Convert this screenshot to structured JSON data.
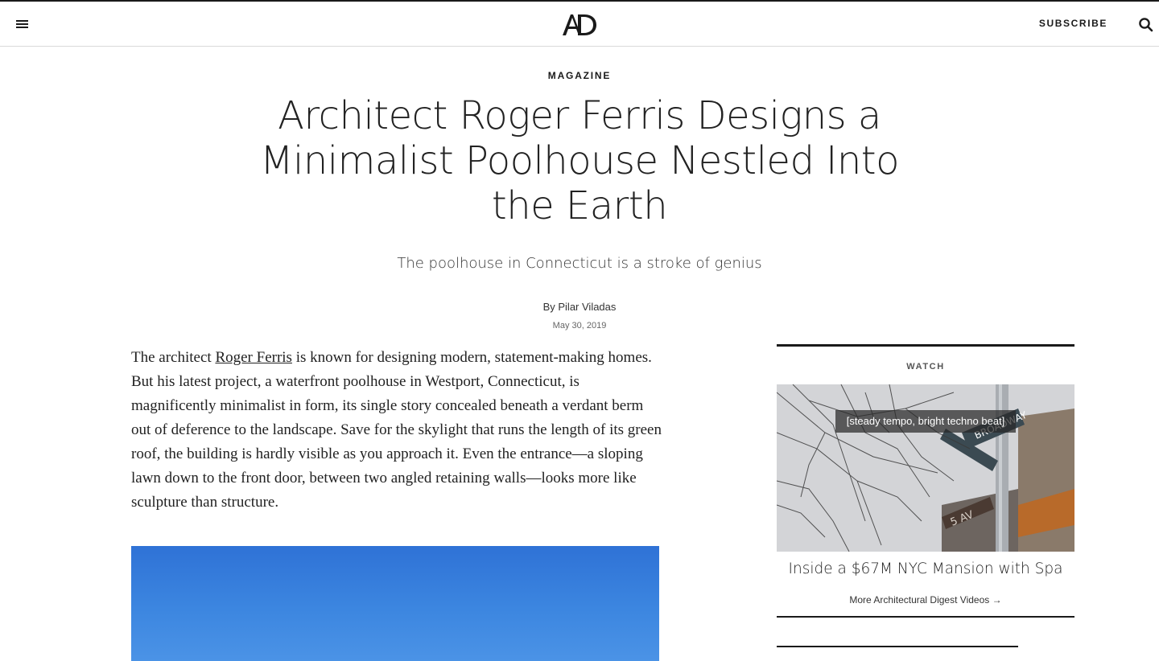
{
  "header": {
    "menu_icon": "hamburger-menu-icon",
    "logo_text": "AD",
    "subscribe_label": "Subscribe",
    "search_icon": "search-icon"
  },
  "article": {
    "rubric": "Magazine",
    "headline": "Architect Roger Ferris Designs a Minimalist Poolhouse Nestled Into the Earth",
    "dek": "The poolhouse in Connecticut is a stroke of genius",
    "byline_prefix": "By ",
    "author": "Pilar Viladas",
    "date": "May 30, 2019",
    "body": {
      "lead": "The architect ",
      "link_text": "Roger Ferris",
      "rest": " is known for designing modern, statement-making homes. But his latest project, a waterfront poolhouse in Westport, Connecticut, is magnificently minimalist in form, its single story concealed beneath a verdant berm out of deference to the landscape. Save for the skylight that runs the length of its green roof, the building is hardly visible as you approach it. Even the entrance—a sloping lawn down to the front door, between two angled retaining walls—looks more like sculpture than structure."
    }
  },
  "sidebar": {
    "watch_label": "Watch",
    "video_caption": "[steady tempo, bright techno beat]",
    "video_title": "Inside a $67M NYC Mansion with Spa",
    "more_link": "More Architectural Digest Videos →",
    "street_sign_text": [
      "BROADWAY",
      "5 AV"
    ]
  },
  "colors": {
    "text": "#1a1a1a",
    "sky_blue": "#3c86e0"
  }
}
